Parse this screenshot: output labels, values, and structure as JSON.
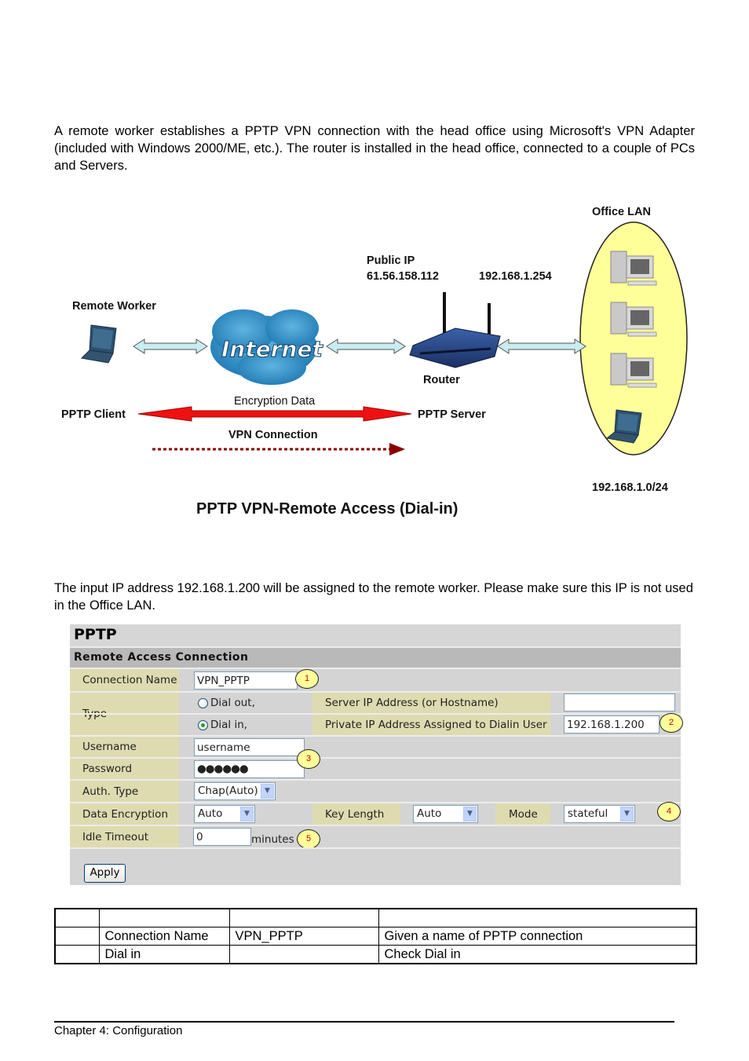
{
  "intro_paragraph": "A remote worker establishes a PPTP VPN connection with the head office using Microsoft's VPN Adapter (included with Windows 2000/ME, etc.). The router is installed in the head office, connected to a couple of PCs and Servers.",
  "diagram": {
    "office_lan_label": "Office LAN",
    "public_ip_label": "Public IP",
    "public_ip": "61.56.158.112",
    "lan_ip": "192.168.1.254",
    "remote_worker_label": "Remote Worker",
    "internet_label": "Internet",
    "router_label": "Router",
    "encryption_label": "Encryption Data",
    "pptp_client_label": "PPTP Client",
    "pptp_server_label": "PPTP Server",
    "vpn_connection_label": "VPN Connection",
    "subnet_label": "192.168.1.0/24",
    "title": "PPTP VPN-Remote Access (Dial-in)",
    "colors": {
      "lan_ellipse": "#ffff99",
      "encryption_arrow": "#ee1111",
      "vpn_arrow": "#8b0000",
      "link_arrow": "#c8ecf0",
      "cloud": "#2f8fc4"
    }
  },
  "second_paragraph": "The input IP address 192.168.1.200 will be assigned to the remote worker. Please make sure this IP is not used in the Office LAN.",
  "form": {
    "title": "PPTP",
    "section": "Remote Access Connection",
    "connection_name_label": "Connection Name",
    "connection_name_value": "VPN_PPTP",
    "type_label": "Type",
    "dial_out_label": "Dial out,",
    "dial_in_label": "Dial in,",
    "dial_in_selected": true,
    "server_ip_label": "Server IP Address (or Hostname)",
    "server_ip_value": "",
    "private_ip_label": "Private IP Address Assigned to Dialin User",
    "private_ip_value": "192.168.1.200",
    "username_label": "Username",
    "username_value": "username",
    "password_label": "Password",
    "password_value": "●●●●●●",
    "auth_type_label": "Auth. Type",
    "auth_type_value": "Chap(Auto)",
    "data_encryption_label": "Data Encryption",
    "data_encryption_value": "Auto",
    "key_length_label": "Key Length",
    "key_length_value": "Auto",
    "mode_label": "Mode",
    "mode_value": "stateful",
    "idle_timeout_label": "Idle Timeout",
    "idle_timeout_value": "0",
    "idle_timeout_unit": "minutes",
    "apply_label": "Apply",
    "badges": [
      "1",
      "2",
      "3",
      "4",
      "5"
    ]
  },
  "reference_table": {
    "rows": [
      [
        "",
        "",
        "",
        ""
      ],
      [
        "",
        "Connection Name",
        "VPN_PPTP",
        "Given a name of PPTP connection"
      ],
      [
        "",
        "Dial in",
        "",
        "Check Dial in"
      ]
    ]
  },
  "footer": {
    "chapter": "Chapter 4: Configuration"
  }
}
